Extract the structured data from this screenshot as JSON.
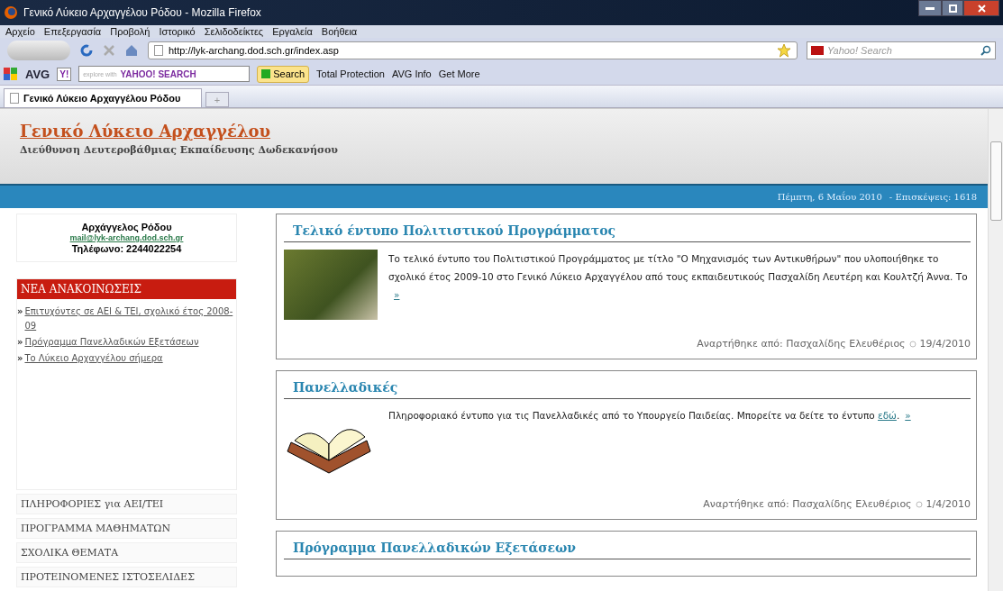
{
  "window": {
    "title": "Γενικό Λύκειο Αρχαγγέλου Ρόδου - Mozilla Firefox"
  },
  "menu": [
    "Αρχείο",
    "Επεξεργασία",
    "Προβολή",
    "Ιστορικό",
    "Σελιδοδείκτες",
    "Εργαλεία",
    "Βοήθεια"
  ],
  "address_bar": {
    "value": "http://lyk-archang.dod.sch.gr/index.asp"
  },
  "search_bar": {
    "placeholder": "Yahoo! Search"
  },
  "avg_toolbar": {
    "brand": "AVG",
    "yahoo_label": "Y!",
    "search_placeholder": "explore with",
    "search_brand": "YAHOO! SEARCH",
    "search_button": "Search",
    "items": [
      "Total Protection",
      "AVG Info",
      "Get More"
    ]
  },
  "tabs": [
    {
      "label": "Γενικό Λύκειο Αρχαγγέλου Ρόδου",
      "selected": true
    }
  ],
  "new_tab": "+",
  "site": {
    "title": "Γενικό Λύκειο Αρχαγγέλου",
    "subtitle": "Διεύθυνση Δευτεροβάθμιας Εκπαίδευσης Δωδεκανήσου",
    "date": "Πέμπτη, 6 Μαΐου 2010",
    "visits": "- Επισκέψεις: 1618"
  },
  "contact": {
    "name": "Αρχάγγελος Ρόδου",
    "email": "mail@lyk-archang.dod.sch.gr",
    "phone": "Τηλέφωνο: 2244022254"
  },
  "news": {
    "heading": "ΝΕΑ ΑΝΑΚΟΙΝΩΣΕΙΣ",
    "bullet": "»",
    "items": [
      "Επιτυχόντες σε ΑΕΙ & ΤΕΙ, σχολικό έτος 2008-09",
      "Πρόγραμμα Πανελλαδικών Εξετάσεων",
      "Το Λύκειο Αρχαγγέλου σήμερα"
    ]
  },
  "sidebar_menu": [
    "ΠΛΗΡΟΦΟΡΙΕΣ για ΑΕΙ/ΤΕΙ",
    "ΠΡΟΓΡΑΜΜΑ ΜΑΘΗΜΑΤΩΝ",
    "ΣΧΟΛΙΚΑ ΘΕΜΑΤΑ",
    "ΠΡΟΤΕΙΝΟΜΕΝΕΣ ΙΣΤΟΣΕΛΙΔΕΣ"
  ],
  "articles": [
    {
      "title": "Τελικό έντυπο Πολιτιστικού Προγράμματος",
      "kind": "photo",
      "body_parts": [
        {
          "kind": "text",
          "text": "Το τελικό έντυπο του Πολιτιστικού Προγράμματος με τίτλο \"Ο Μηχανισμός των Αντικυθήρων\" που υλοποιήθηκε το σχολικό έτος 2009-10 στο Γενικό Λύκειο Αρχαγγέλου από τους εκπαιδευτικούς Πασχαλίδη Λευτέρη και Κουλτζή Άννα. Το "
        }
      ],
      "more": "»",
      "posted_by": "Αναρτήθηκε από: Πασχαλίδης Ελευθέριος",
      "date": "19/4/2010"
    },
    {
      "title": "Πανελλαδικές",
      "kind": "book",
      "body_parts": [
        {
          "kind": "text",
          "text": "Πληροφοριακό έντυπο για τις Πανελλαδικές από το Υπουργείο Παιδείας. Μπορείτε να δείτε το έντυπο "
        },
        {
          "kind": "link",
          "text": "εδώ"
        },
        {
          "kind": "text",
          "text": "."
        }
      ],
      "more": "»",
      "posted_by": "Αναρτήθηκε από: Πασχαλίδης Ελευθέριος",
      "date": "1/4/2010"
    },
    {
      "title": "Πρόγραμμα Πανελλαδικών Εξετάσεων",
      "kind": "heading_only"
    }
  ]
}
